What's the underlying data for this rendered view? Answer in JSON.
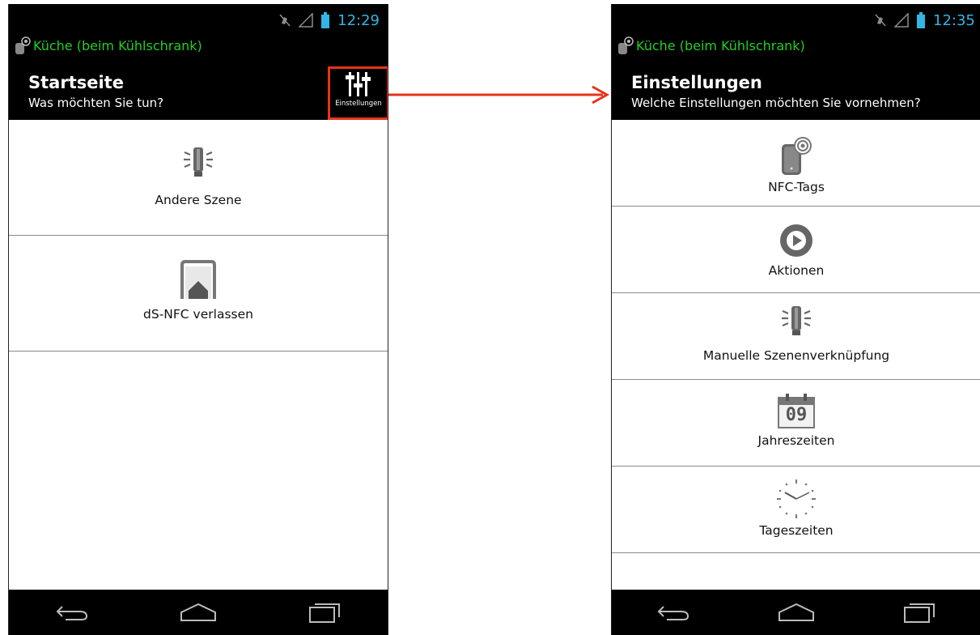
{
  "status_bar": {
    "left_time": "12:29",
    "right_time": "12:35",
    "location": "Küche (beim Kühlschrank)"
  },
  "left_screen": {
    "title": "Startseite",
    "subtitle": "Was möchten Sie tun?",
    "settings_button_label": "Einstellungen",
    "items": [
      {
        "label": "Andere Szene",
        "icon": "light-bulb-icon"
      },
      {
        "label": "dS-NFC verlassen",
        "icon": "exit-icon"
      }
    ]
  },
  "right_screen": {
    "title": "Einstellungen",
    "subtitle": "Welche Einstellungen möchten Sie vornehmen?",
    "items": [
      {
        "label": "NFC-Tags",
        "icon": "nfc-tag-icon"
      },
      {
        "label": "Aktionen",
        "icon": "play-icon"
      },
      {
        "label": "Manuelle Szenenverknüpfung",
        "icon": "light-bulb-icon"
      },
      {
        "label": "Jahreszeiten",
        "icon": "calendar-icon",
        "calendar_day": "09"
      },
      {
        "label": "Tageszeiten",
        "icon": "clock-icon"
      }
    ]
  },
  "colors": {
    "accent_highlight": "#e8331a",
    "clock_blue": "#33b5e5",
    "location_green": "#21d021"
  }
}
